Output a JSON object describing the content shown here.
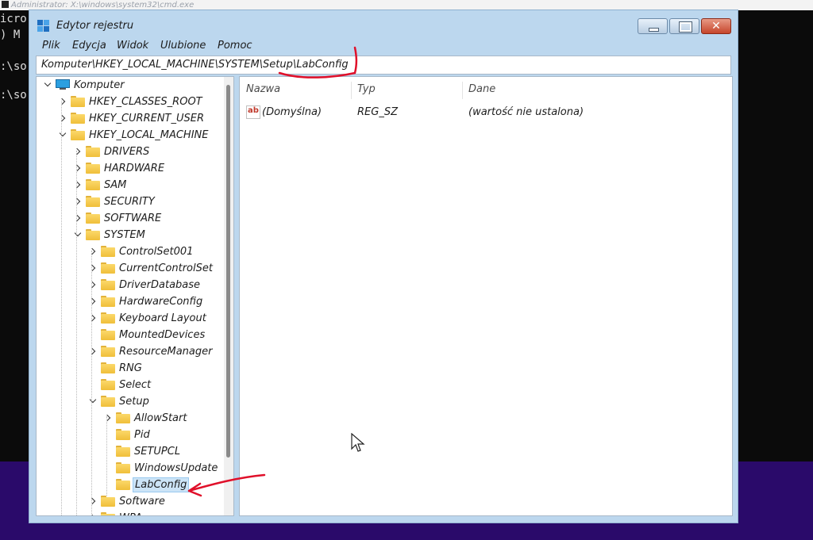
{
  "background_console": {
    "title": "Administrator: X:\\windows\\system32\\cmd.exe",
    "lines": [
      "icro",
      ") M",
      ":\\so",
      ":\\so"
    ]
  },
  "window": {
    "title": "Edytor rejestru",
    "close_glyph": "✕"
  },
  "menu": [
    "Plik",
    "Edycja",
    "Widok",
    "Ulubione",
    "Pomoc"
  ],
  "address": "Komputer\\HKEY_LOCAL_MACHINE\\SYSTEM\\Setup\\LabConfig",
  "tree": [
    {
      "label": "Komputer",
      "expander": "down",
      "icon": "computer-icon"
    },
    {
      "label": "HKEY_CLASSES_ROOT",
      "expander": "right",
      "icon": "folder-icon"
    },
    {
      "label": "HKEY_CURRENT_USER",
      "expander": "right",
      "icon": "folder-icon"
    },
    {
      "label": "HKEY_LOCAL_MACHINE",
      "expander": "down",
      "icon": "folder-icon"
    },
    {
      "label": "DRIVERS",
      "expander": "right",
      "icon": "folder-icon"
    },
    {
      "label": "HARDWARE",
      "expander": "right",
      "icon": "folder-icon"
    },
    {
      "label": "SAM",
      "expander": "right",
      "icon": "folder-icon"
    },
    {
      "label": "SECURITY",
      "expander": "right",
      "icon": "folder-icon"
    },
    {
      "label": "SOFTWARE",
      "expander": "right",
      "icon": "folder-icon"
    },
    {
      "label": "SYSTEM",
      "expander": "down",
      "icon": "folder-icon"
    },
    {
      "label": "ControlSet001",
      "expander": "right",
      "icon": "folder-icon"
    },
    {
      "label": "CurrentControlSet",
      "expander": "right",
      "icon": "folder-icon"
    },
    {
      "label": "DriverDatabase",
      "expander": "right",
      "icon": "folder-icon"
    },
    {
      "label": "HardwareConfig",
      "expander": "right",
      "icon": "folder-icon"
    },
    {
      "label": "Keyboard Layout",
      "expander": "right",
      "icon": "folder-icon"
    },
    {
      "label": "MountedDevices",
      "expander": "none",
      "icon": "folder-icon"
    },
    {
      "label": "ResourceManager",
      "expander": "right",
      "icon": "folder-icon"
    },
    {
      "label": "RNG",
      "expander": "none",
      "icon": "folder-icon"
    },
    {
      "label": "Select",
      "expander": "none",
      "icon": "folder-icon"
    },
    {
      "label": "Setup",
      "expander": "down",
      "icon": "folder-icon"
    },
    {
      "label": "AllowStart",
      "expander": "right",
      "icon": "folder-icon"
    },
    {
      "label": "Pid",
      "expander": "none",
      "icon": "folder-icon"
    },
    {
      "label": "SETUPCL",
      "expander": "none",
      "icon": "folder-icon"
    },
    {
      "label": "WindowsUpdate",
      "expander": "none",
      "icon": "folder-icon"
    },
    {
      "label": "LabConfig",
      "expander": "none",
      "icon": "folder-icon",
      "selected": true
    },
    {
      "label": "Software",
      "expander": "right",
      "icon": "folder-icon"
    },
    {
      "label": "WPA",
      "expander": "right",
      "icon": "folder-icon"
    }
  ],
  "list": {
    "columns": [
      "Nazwa",
      "Typ",
      "Dane"
    ],
    "rows": [
      {
        "name": "(Domyślna)",
        "type": "REG_SZ",
        "data": "(wartość nie ustalona)",
        "icon": "string-value-icon"
      }
    ]
  },
  "colors": {
    "annotation": "#e0102a",
    "desktop": "#2a0a6a",
    "frame": "#bcd7ee",
    "selection": "#cce4f7"
  }
}
